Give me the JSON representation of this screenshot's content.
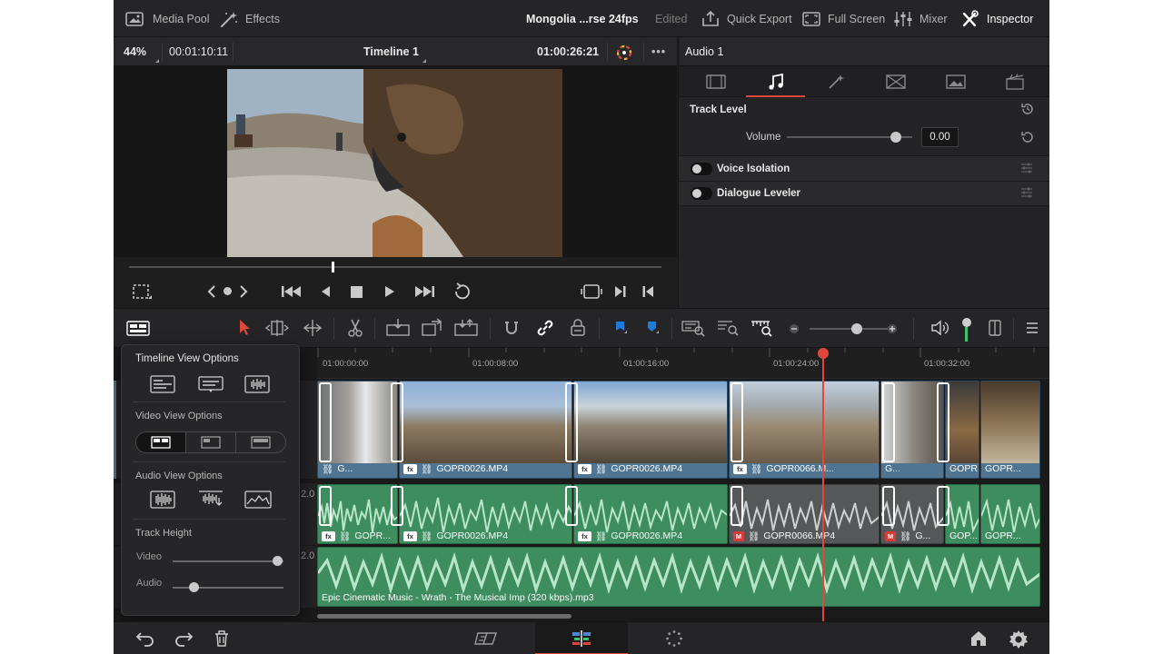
{
  "topbar": {
    "media_pool": "Media Pool",
    "effects": "Effects",
    "project_title": "Mongolia ...rse 24fps",
    "status": "Edited",
    "quick_export": "Quick Export",
    "full_screen": "Full Screen",
    "mixer": "Mixer",
    "inspector": "Inspector"
  },
  "viewer": {
    "zoom": "44%",
    "source_timecode": "00:01:10:11",
    "timeline_name": "Timeline 1",
    "record_timecode": "01:00:26:21",
    "scrubber_fraction": 0.38
  },
  "inspector": {
    "clip_name": "Audio 1",
    "tabs": [
      "video-tab",
      "audio-tab",
      "effects-tab",
      "transition-tab",
      "image-tab",
      "file-tab"
    ],
    "active_tab": "audio-tab",
    "track_level_title": "Track Level",
    "volume_label": "Volume",
    "volume_value": "0.00",
    "volume_fraction": 0.87,
    "voice_isolation": "Voice Isolation",
    "dialogue_leveler": "Dialogue Leveler"
  },
  "timeline": {
    "ruler": [
      "01:00:00:00",
      "01:00:08:00",
      "01:00:16:00",
      "01:00:24:00",
      "01:00:32:00"
    ],
    "track_level_labels": [
      "2.0",
      "2.0"
    ],
    "video_clips": [
      "G...",
      "GOPR0026.MP4",
      "GOPR0026.MP4",
      "GOPR0066.M...",
      "G...",
      "GOPR...",
      "GOPR..."
    ],
    "audio_clips": [
      "GOPR...",
      "GOPR0026.MP4",
      "GOPR0026.MP4",
      "GOPR0066.MP4",
      "G...",
      "GOP...",
      "GOPR..."
    ],
    "music_clip": "Epic Cinematic Music - Wrath - The Musical Imp (320 kbps).mp3",
    "fx_badge": "fx",
    "m_badge": "M",
    "zoom_fraction": 0.6
  },
  "popover": {
    "title": "Timeline View Options",
    "video_view": "Video View Options",
    "audio_view": "Audio View Options",
    "track_height": "Track Height",
    "video_label": "Video",
    "audio_label": "Audio",
    "video_height_fraction": 0.95,
    "audio_height_fraction": 0.19
  },
  "colors": {
    "accent_red": "#e0463c",
    "video_clip": "#4f7593",
    "audio_clip": "#3d8d5f",
    "audio_level": "#3ec46d"
  }
}
